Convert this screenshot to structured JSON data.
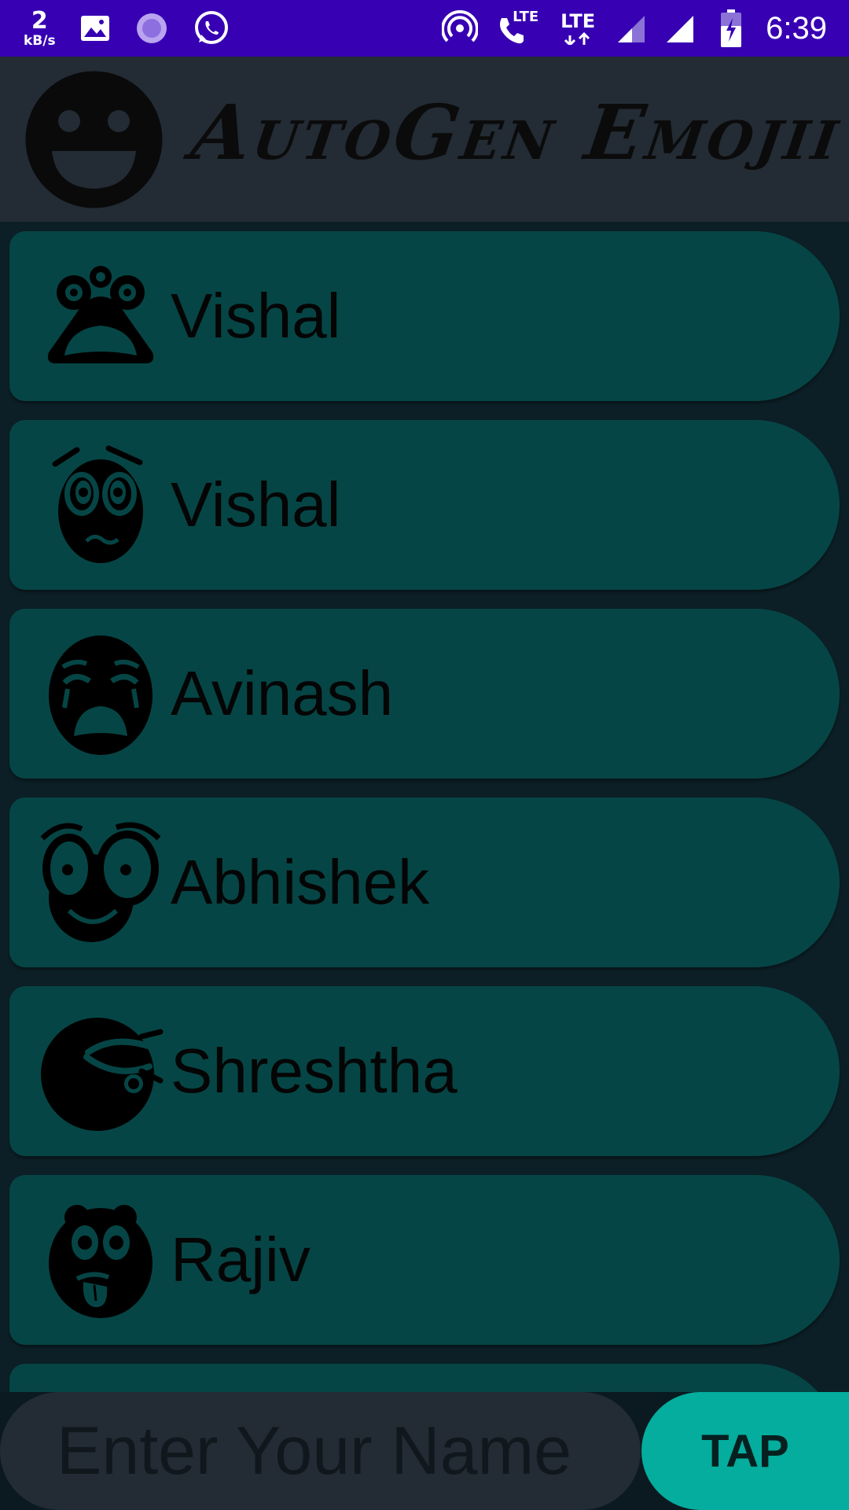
{
  "status_bar": {
    "net_speed_value": "2",
    "net_speed_unit": "kB/s",
    "lte_label_1": "LTE",
    "lte_label_2": "LTE",
    "time": "6:39",
    "bg_color": "#3700b3",
    "icons": [
      "image-icon",
      "loading-icon",
      "whatsapp-icon",
      "hotspot-icon",
      "volte-call-icon",
      "lte-data-icon",
      "signal-icon",
      "signal-full-icon",
      "battery-charging-icon"
    ]
  },
  "header": {
    "app_title": "AutoGen Emojii",
    "logo_icon": "smiley-logo-icon",
    "bg_color": "#232b34"
  },
  "contacts": [
    {
      "name": "Vishal",
      "emoji": "frog-face-icon"
    },
    {
      "name": "Vishal",
      "emoji": "worried-face-icon"
    },
    {
      "name": "Avinash",
      "emoji": "crying-face-icon"
    },
    {
      "name": "Abhishek",
      "emoji": "surprised-face-icon"
    },
    {
      "name": "Shreshtha",
      "emoji": "dizzy-face-icon"
    },
    {
      "name": "Rajiv",
      "emoji": "tongue-out-face-icon"
    },
    {
      "name": "",
      "emoji": "partial-face-icon"
    }
  ],
  "colors": {
    "card": "#064545",
    "list_bg": "#0c1f26",
    "accent": "#04ad9e"
  },
  "input": {
    "placeholder": "Enter Your Name",
    "value": ""
  },
  "tap_button": {
    "label": "TAP"
  }
}
